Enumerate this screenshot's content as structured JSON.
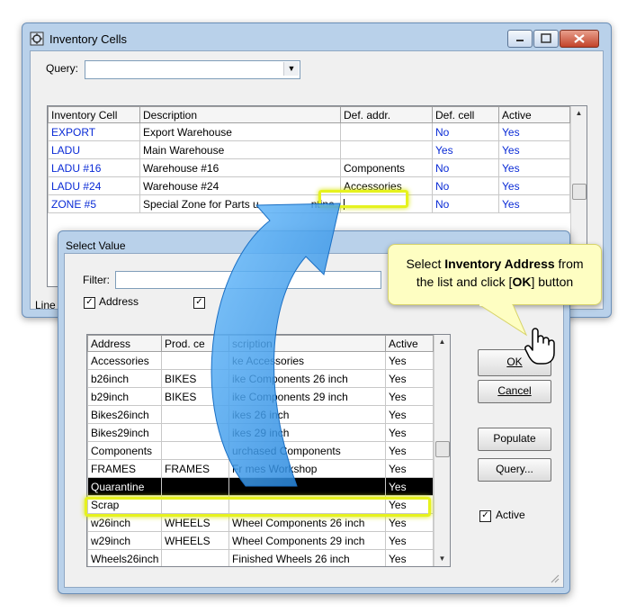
{
  "main_window": {
    "title": "Inventory Cells",
    "query_label": "Query:",
    "query_value": "",
    "columns": [
      "Inventory Cell",
      "Description",
      "Def. addr.",
      "Def. cell",
      "Active"
    ],
    "rows": [
      {
        "cell": "EXPORT",
        "description": "Export Warehouse",
        "def_addr": "",
        "def_cell": "No",
        "active": "Yes"
      },
      {
        "cell": "LADU",
        "description": "Main Warehouse",
        "def_addr": "",
        "def_cell": "Yes",
        "active": "Yes"
      },
      {
        "cell": "LADU #16",
        "description": "Warehouse #16",
        "def_addr": "Components",
        "def_cell": "No",
        "active": "Yes"
      },
      {
        "cell": "LADU #24",
        "description": "Warehouse #24",
        "def_addr": "Accessories",
        "def_cell": "No",
        "active": "Yes"
      },
      {
        "cell": "ZONE #5",
        "description": "Special Zone for Parts u",
        "description_tail": "ntine",
        "def_addr": "",
        "def_cell": "No",
        "active": "Yes"
      }
    ],
    "status_text": "Line"
  },
  "dialog": {
    "title": "Select Value",
    "filter_label": "Filter:",
    "filter_value": "",
    "address_checkbox_label": "Address",
    "address_checked": true,
    "columns": [
      "Address",
      "Prod. ce",
      "scription",
      "Active"
    ],
    "rows": [
      {
        "address": "Accessories",
        "prod": "",
        "description": "ke Accessories",
        "active": "Yes"
      },
      {
        "address": "b26inch",
        "prod": "BIKES",
        "description": "ike Components 26 inch",
        "active": "Yes"
      },
      {
        "address": "b29inch",
        "prod": "BIKES",
        "description": "ike Components 29 inch",
        "active": "Yes"
      },
      {
        "address": "Bikes26inch",
        "prod": "",
        "description": "ikes 26 inch",
        "active": "Yes"
      },
      {
        "address": "Bikes29inch",
        "prod": "",
        "description": "ikes 29 inch",
        "active": "Yes"
      },
      {
        "address": "Components",
        "prod": "",
        "description": "urchased Components",
        "active": "Yes"
      },
      {
        "address": "FRAMES",
        "prod": "FRAMES",
        "description": "Fr  mes Workshop",
        "active": "Yes"
      },
      {
        "address": "Quarantine",
        "prod": "",
        "description": "",
        "active": "Yes"
      },
      {
        "address": "Scrap",
        "prod": "",
        "description": "",
        "active": "Yes"
      },
      {
        "address": "w26inch",
        "prod": "WHEELS",
        "description": "Wheel Components 26 inch",
        "active": "Yes"
      },
      {
        "address": "w29inch",
        "prod": "WHEELS",
        "description": "Wheel Components 29 inch",
        "active": "Yes"
      },
      {
        "address": "Wheels26inch",
        "prod": "",
        "description": "Finished Wheels 26 inch",
        "active": "Yes"
      }
    ],
    "buttons": {
      "ok": "OK",
      "cancel": "Cancel",
      "populate": "Populate",
      "query": "Query..."
    },
    "active_checkbox_label": "Active",
    "active_checked": true
  },
  "callout": {
    "line1_prefix": "Select ",
    "line1_bold": "Inventory Address",
    "line1_suffix": " from",
    "line2_prefix": "the list and click [",
    "line2_bold": "OK",
    "line2_suffix": "] button"
  },
  "colors": {
    "highlight": "#e6f21e",
    "link_blue": "#0a2bd6",
    "arrow_blue": "#2a8fe0",
    "callout_bg": "#fefec2"
  }
}
